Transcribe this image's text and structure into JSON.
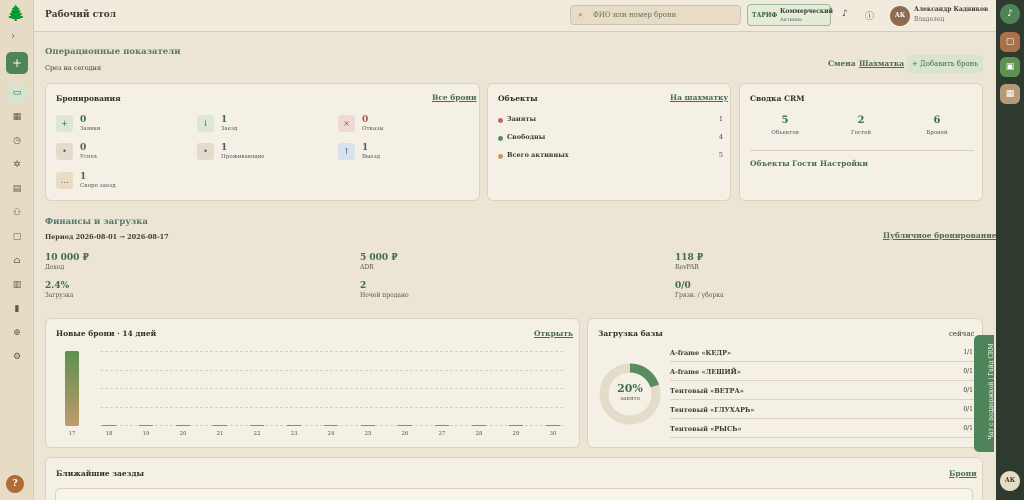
{
  "header": {
    "title": "Рабочий стол",
    "search_placeholder": "ФИО или номер брони",
    "tariff_label": "ТАРИФ",
    "tariff_name": "Коммерческий",
    "tariff_status": "Активна",
    "user_initials": "АК",
    "user_name": "Александр Кадников",
    "user_role": "Владелец"
  },
  "ops": {
    "title": "Операционные показатели",
    "subtitle": "Срез на сегодня",
    "shift_link": "Смена",
    "chess_link": "Шахматка",
    "add_button": "+ Добавить бронь"
  },
  "bookings": {
    "title": "Бронирования",
    "all_link": "Все брони",
    "items": [
      {
        "icon": "+",
        "value": "0",
        "label": "Заявки",
        "bg": "#dbe8d8",
        "fg": "#3d6e47"
      },
      {
        "icon": "↓",
        "value": "1",
        "label": "Заезд",
        "bg": "#dbe8d8",
        "fg": "#3d6e47"
      },
      {
        "icon": "×",
        "value": "0",
        "label": "Отказы",
        "bg": "#f0d9d4",
        "fg": "#b0564a"
      },
      {
        "icon": "•",
        "value": "0",
        "label": "Успех",
        "bg": "#e3dccd",
        "fg": "#555"
      },
      {
        "icon": "•",
        "value": "1",
        "label": "Проживающие",
        "bg": "#e3dccd",
        "fg": "#555"
      },
      {
        "icon": "↑",
        "value": "1",
        "label": "Выезд",
        "bg": "#d8e2ee",
        "fg": "#3a5f8a"
      },
      {
        "icon": "…",
        "value": "1",
        "label": "Скоро заезд",
        "bg": "#e8dcc2",
        "fg": "#6c5a3a"
      }
    ]
  },
  "objects": {
    "title": "Объекты",
    "chess_link": "На шахматку",
    "rows": [
      {
        "label": "Заняты",
        "value": "1",
        "color": "#c06a5c"
      },
      {
        "label": "Свободны",
        "value": "4",
        "color": "#5a8c5e"
      },
      {
        "label": "Всего активных",
        "value": "5",
        "color": "#c09a6a"
      }
    ]
  },
  "crm": {
    "title": "Сводка CRM",
    "stats": [
      {
        "value": "5",
        "label": "Объектов"
      },
      {
        "value": "2",
        "label": "Гостей"
      },
      {
        "value": "6",
        "label": "Броней"
      }
    ],
    "links": [
      "Объекты",
      "Гости",
      "Настройки"
    ]
  },
  "finance": {
    "title": "Финансы и загрузка",
    "period": "Период 2026-08-01 → 2026-08-17",
    "public_link": "Публичное бронирование",
    "metrics": [
      {
        "value": "10 000 ₽",
        "label": "Доход"
      },
      {
        "value": "5 000 ₽",
        "label": "ADR"
      },
      {
        "value": "118 ₽",
        "label": "RevPAR"
      },
      {
        "value": "2.4%",
        "label": "Загрузка"
      },
      {
        "value": "2",
        "label": "Ночей продано"
      },
      {
        "value": "0/0",
        "label": "Грязн. / уборка"
      }
    ]
  },
  "new_bookings": {
    "title": "Новые брони · 14 дней",
    "open_link": "Открыть"
  },
  "chart_data": {
    "type": "bar",
    "title": "Новые брони · 14 дней",
    "categories": [
      "17",
      "18",
      "19",
      "20",
      "21",
      "22",
      "23",
      "24",
      "25",
      "26",
      "27",
      "28",
      "29",
      "30"
    ],
    "values": [
      1,
      0,
      0,
      0,
      0,
      0,
      0,
      0,
      0,
      0,
      0,
      0,
      0,
      0
    ],
    "ylim": [
      0,
      1
    ]
  },
  "load": {
    "title": "Загрузка базы",
    "now_label": "сейчас",
    "percent": 20,
    "percent_label": "20%",
    "occupied_label": "занято",
    "units": [
      {
        "name": "A-frame «КЕДР»",
        "value": "1/1"
      },
      {
        "name": "A-frame «ЛЕШИЙ»",
        "value": "0/1"
      },
      {
        "name": "Тентовый «ВЕТРА»",
        "value": "0/1"
      },
      {
        "name": "Тентовый «ГЛУХАРЬ»",
        "value": "0/1"
      },
      {
        "name": "Тентовый «РЫСЬ»",
        "value": "0/1"
      }
    ]
  },
  "arrivals": {
    "title": "Ближайшие заезды",
    "link": "Брони"
  },
  "chat_tab": "Чат с поддержкой | Гайд CRM",
  "help_label": "?",
  "rail_avatar": "АК"
}
